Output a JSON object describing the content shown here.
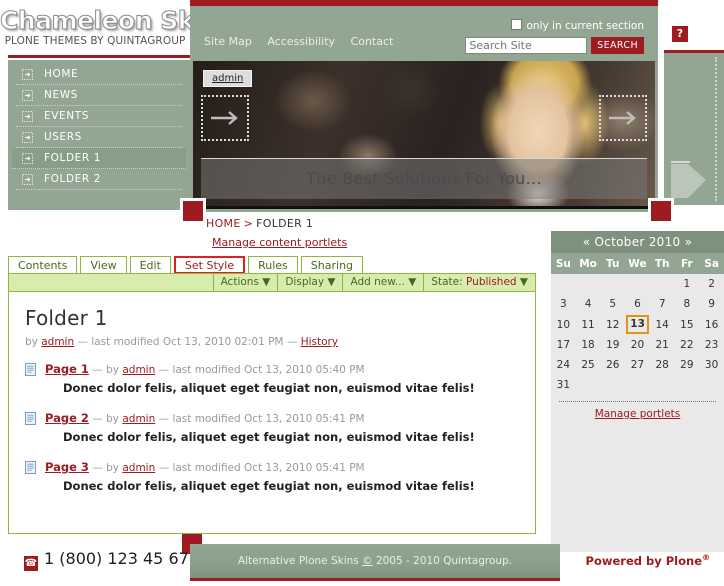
{
  "brand": {
    "title": "Chameleon Skin",
    "subtitle": "PLONE THEMES BY QUINTAGROUP"
  },
  "sidebar": {
    "items": [
      {
        "label": "HOME",
        "icon": "arrow-box-icon",
        "selected": false
      },
      {
        "label": "NEWS",
        "icon": "arrow-box-icon",
        "selected": false
      },
      {
        "label": "EVENTS",
        "icon": "arrow-box-icon",
        "selected": false
      },
      {
        "label": "USERS",
        "icon": "arrow-box-icon",
        "selected": false
      },
      {
        "label": "FOLDER 1",
        "icon": "arrow-box-icon",
        "selected": true
      },
      {
        "label": "FOLDER 2",
        "icon": "arrow-box-icon",
        "selected": false
      }
    ]
  },
  "header": {
    "links": [
      {
        "label": "Site Map"
      },
      {
        "label": "Accessibility"
      },
      {
        "label": "Contact"
      }
    ],
    "checkbox_label": "only in current section",
    "search_value": "",
    "search_placeholder": "Search Site",
    "search_button": "SEARCH",
    "help_icon_label": "?"
  },
  "banner": {
    "admin_label": "admin",
    "caption": "The Best Solutions For You...",
    "prev_icon": "arrow-right-icon",
    "next_icon": "arrow-right-icon"
  },
  "breadcrumb": {
    "home": "HOME",
    "separator": ">",
    "current": "FOLDER 1",
    "manage_portlets": "Manage content portlets"
  },
  "tabs": [
    {
      "label": "Contents",
      "state": "normal"
    },
    {
      "label": "View",
      "state": "active"
    },
    {
      "label": "Edit",
      "state": "normal"
    },
    {
      "label": "Set Style",
      "state": "highlighted"
    },
    {
      "label": "Rules",
      "state": "normal"
    },
    {
      "label": "Sharing",
      "state": "normal"
    }
  ],
  "actionbar": {
    "actions": "Actions",
    "display": "Display",
    "add_new": "Add new...",
    "state_prefix": "State:",
    "state_value": "Published",
    "caret": "▼"
  },
  "document": {
    "title": "Folder 1",
    "byline_prefix": "by",
    "byline_author": "admin",
    "byline_dash": "—",
    "byline_modified": "last modified Oct 13, 2010 02:01 PM",
    "history_label": "History",
    "entries": [
      {
        "title": "Page 1",
        "by": "by",
        "author": "admin",
        "modified": "last modified Oct 13, 2010 05:40 PM",
        "description": "Donec dolor felis, aliquet eget feugiat non, euismod vitae felis!"
      },
      {
        "title": "Page 2",
        "by": "by",
        "author": "admin",
        "modified": "last modified Oct 13, 2010 05:41 PM",
        "description": "Donec dolor felis, aliquet eget feugiat non, euismod vitae felis!"
      },
      {
        "title": "Page 3",
        "by": "by",
        "author": "admin",
        "modified": "last modified Oct 13, 2010 05:41 PM",
        "description": "Donec dolor felis, aliquet eget feugiat non, euismod vitae felis!"
      }
    ]
  },
  "calendar": {
    "prev": "«",
    "month_year": "October 2010",
    "next": "»",
    "dow": [
      "Su",
      "Mo",
      "Tu",
      "We",
      "Th",
      "Fr",
      "Sa"
    ],
    "weeks": [
      [
        "",
        "",
        "",
        "",
        "",
        "1",
        "2"
      ],
      [
        "3",
        "4",
        "5",
        "6",
        "7",
        "8",
        "9"
      ],
      [
        "10",
        "11",
        "12",
        "13",
        "14",
        "15",
        "16"
      ],
      [
        "17",
        "18",
        "19",
        "20",
        "21",
        "22",
        "23"
      ],
      [
        "24",
        "25",
        "26",
        "27",
        "28",
        "29",
        "30"
      ],
      [
        "31",
        "",
        "",
        "",
        "",
        "",
        ""
      ]
    ],
    "today": "13",
    "manage_portlets": "Manage portlets"
  },
  "footer": {
    "phone": "1 (800) 123 45 67",
    "phone_icon": "phone-icon",
    "copyright_pre": "Alternative Plone Skins ",
    "copyright_sym": "©",
    "copyright_post": " 2005 - 2010 Quintagroup.",
    "powered_by": "Powered by Plone",
    "powered_sup": "®"
  },
  "colors": {
    "brand_red": "#9e1b20",
    "sage_green": "#93a593",
    "tab_green": "#8cb83c",
    "actionbar_green": "#d9ecb0",
    "today_orange": "#e8901a",
    "portlet_grey": "#e9e9e9"
  }
}
